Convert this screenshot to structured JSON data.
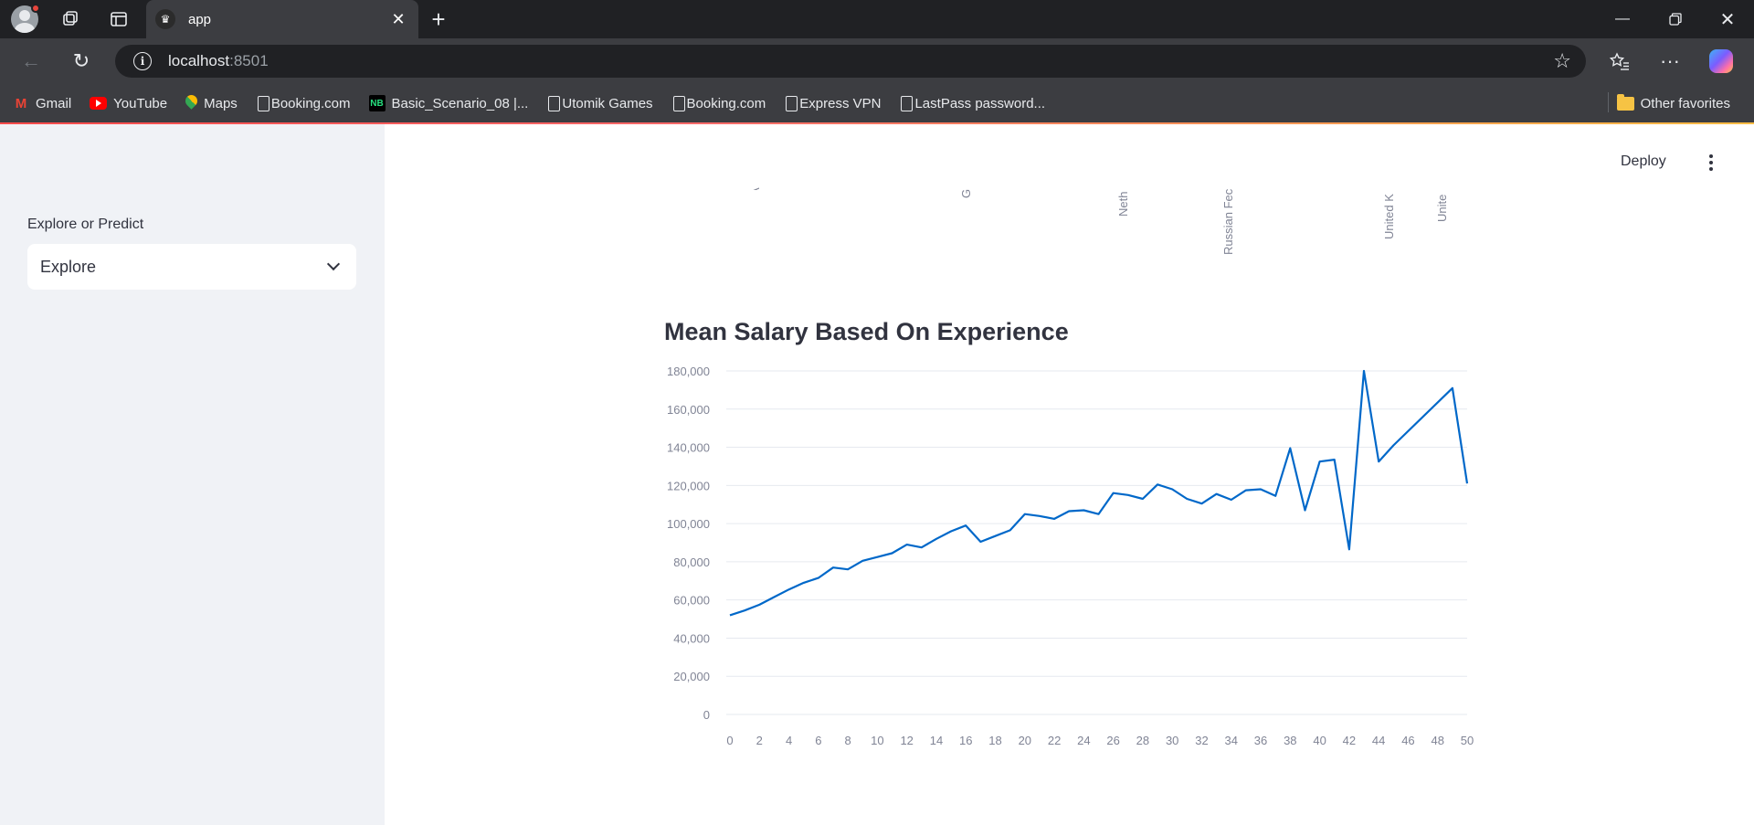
{
  "browser": {
    "tab_title": "app",
    "url_host": "localhost",
    "url_port": ":8501",
    "bookmarks": [
      {
        "label": "Gmail",
        "icon": "gmail-icon"
      },
      {
        "label": "YouTube",
        "icon": "youtube-icon"
      },
      {
        "label": "Maps",
        "icon": "maps-icon"
      },
      {
        "label": "Booking.com",
        "icon": "page-icon"
      },
      {
        "label": "Basic_Scenario_08 |...",
        "icon": "nb-icon"
      },
      {
        "label": "Utomik Games",
        "icon": "page-icon"
      },
      {
        "label": "Booking.com",
        "icon": "page-icon"
      },
      {
        "label": "Express VPN",
        "icon": "page-icon"
      },
      {
        "label": "LastPass password...",
        "icon": "page-icon"
      }
    ],
    "other_favorites": "Other favorites"
  },
  "sidebar": {
    "select_label": "Explore or Predict",
    "select_value": "Explore"
  },
  "header": {
    "deploy_label": "Deploy"
  },
  "previous_chart": {
    "visible_tick_labels": [
      "A",
      "G",
      "Neth",
      "Russian Fec",
      "United K",
      "Unite"
    ]
  },
  "chart_data": {
    "type": "line",
    "title": "Mean Salary Based On Experience",
    "xlabel": "",
    "ylabel": "",
    "xlim": [
      0,
      50
    ],
    "ylim": [
      0,
      180000
    ],
    "x_ticks": [
      0,
      2,
      4,
      6,
      8,
      10,
      12,
      14,
      16,
      18,
      20,
      22,
      24,
      26,
      28,
      30,
      32,
      34,
      36,
      38,
      40,
      42,
      44,
      46,
      48,
      50
    ],
    "y_ticks": [
      0,
      20000,
      40000,
      60000,
      80000,
      100000,
      120000,
      140000,
      160000,
      180000
    ],
    "y_tick_labels": [
      "0",
      "20,000",
      "40,000",
      "60,000",
      "80,000",
      "100,000",
      "120,000",
      "140,000",
      "160,000",
      "180,000"
    ],
    "grid": true,
    "color": "#0068c9",
    "series": [
      {
        "x": [
          0,
          1,
          2,
          3,
          4,
          5,
          6,
          7,
          8,
          9,
          10,
          11,
          12,
          13,
          14,
          15,
          16,
          17,
          18,
          19,
          20,
          21,
          22,
          23,
          24,
          25,
          26,
          27,
          28,
          29,
          30,
          31,
          32,
          33,
          34,
          35,
          36,
          37,
          38,
          39,
          40,
          41,
          42,
          43,
          44,
          45,
          49,
          50
        ],
        "y": [
          52000,
          54500,
          57500,
          61500,
          65500,
          69000,
          71500,
          77000,
          76000,
          80500,
          82500,
          84500,
          89000,
          87500,
          92000,
          96000,
          99000,
          90500,
          93500,
          96500,
          105000,
          104000,
          102500,
          106500,
          107000,
          105000,
          116000,
          115000,
          113000,
          120500,
          118000,
          113000,
          110500,
          115500,
          112500,
          117500,
          118000,
          114500,
          139500,
          107000,
          132500,
          133500,
          86500,
          180000,
          132500,
          141000,
          171000,
          121000
        ]
      }
    ]
  }
}
